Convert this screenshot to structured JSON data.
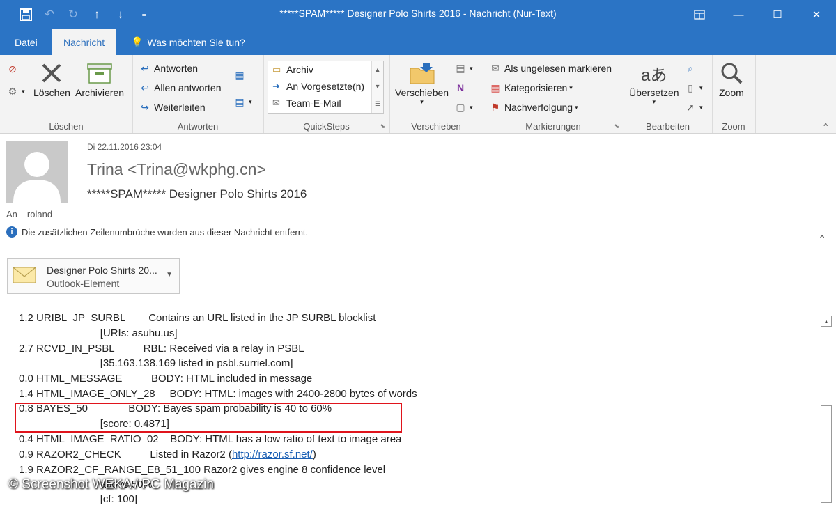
{
  "window": {
    "title": "*****SPAM***** Designer Polo Shirts 2016  -  Nachricht (Nur-Text)"
  },
  "quick_access": [
    "save-icon",
    "undo-icon",
    "redo-icon",
    "up-arrow-icon",
    "down-arrow-icon",
    "customize-icon"
  ],
  "tabs": {
    "file": "Datei",
    "message": "Nachricht",
    "tellme": "Was möchten Sie tun?"
  },
  "ribbon": {
    "delete_group": {
      "label": "Löschen",
      "delete": "Löschen",
      "archive": "Archivieren"
    },
    "respond_group": {
      "label": "Antworten",
      "reply": "Antworten",
      "reply_all": "Allen antworten",
      "forward": "Weiterleiten"
    },
    "quicksteps_group": {
      "label": "QuickSteps",
      "items": [
        "Archiv",
        "An Vorgesetzte(n)",
        "Team-E-Mail"
      ]
    },
    "move_group": {
      "label": "Verschieben",
      "move": "Verschieben"
    },
    "tags_group": {
      "label": "Markierungen",
      "unread": "Als ungelesen markieren",
      "categorize": "Kategorisieren",
      "followup": "Nachverfolgung"
    },
    "edit_group": {
      "label": "Bearbeiten",
      "translate": "Übersetzen"
    },
    "zoom_group": {
      "label": "Zoom",
      "zoom": "Zoom"
    }
  },
  "header": {
    "date": "Di 22.11.2016 23:04",
    "from": "Trina <Trina@wkphg.cn>",
    "subject": "*****SPAM***** Designer Polo Shirts 2016",
    "to_label": "An",
    "to_value": "roland",
    "info": "Die zusätzlichen Zeilenumbrüche wurden aus dieser Nachricht entfernt."
  },
  "attachment": {
    "name": "Designer Polo Shirts 20...",
    "type": "Outlook-Element"
  },
  "body_lines": [
    "1.2 URIBL_JP_SURBL        Contains an URL listed in the JP SURBL blocklist",
    "                            [URIs: asuhu.us]",
    "2.7 RCVD_IN_PSBL          RBL: Received via a relay in PSBL",
    "                            [35.163.138.169 listed in psbl.surriel.com]",
    "0.0 HTML_MESSAGE          BODY: HTML included in message",
    "1.4 HTML_IMAGE_ONLY_28     BODY: HTML: images with 2400-2800 bytes of words",
    "0.8 BAYES_50              BODY: Bayes spam probability is 40 to 60%",
    "                            [score: 0.4871]",
    "0.4 HTML_IMAGE_RATIO_02    BODY: HTML has a low ratio of text to image area",
    "0.9 RAZOR2_CHECK          Listed in Razor2 (",
    "1.9 RAZOR2_CF_RANGE_E8_51_100 Razor2 gives engine 8 confidence level",
    "                            above 50%",
    "                            [cf: 100]"
  ],
  "razor_link": "http://razor.sf.net/",
  "razor_close": ")",
  "watermark": "© Screenshot WEKA / PC Magazin",
  "colors": {
    "titlebar": "#2b74c5",
    "highlight": "#e0141c",
    "link": "#1a5fb4"
  }
}
